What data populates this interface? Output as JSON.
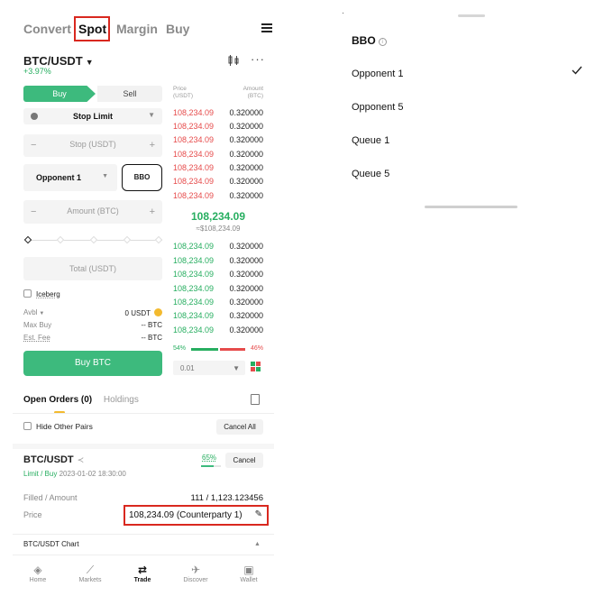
{
  "topnav": {
    "tabs": [
      "Convert",
      "Spot",
      "Margin",
      "Buy"
    ],
    "active": "Spot"
  },
  "pair": {
    "name": "BTC/USDT",
    "change": "+3.97%"
  },
  "form": {
    "buy_label": "Buy",
    "sell_label": "Sell",
    "order_type": "Stop Limit",
    "stop_placeholder": "Stop (USDT)",
    "price_type": "Opponent 1",
    "bbo_label": "BBO",
    "amount_placeholder": "Amount (BTC)",
    "total_placeholder": "Total (USDT)",
    "iceberg_label": "Iceberg",
    "avbl_label": "Avbl",
    "avbl_value": "0 USDT",
    "maxbuy_label": "Max Buy",
    "maxbuy_value": "-- BTC",
    "estfee_label": "Est. Fee",
    "estfee_value": "-- BTC",
    "submit_label": "Buy BTC",
    "minus": "−",
    "plus": "+"
  },
  "orderbook": {
    "price_header": "Price\n(USDT)",
    "amount_header": "Amount\n(BTC)",
    "asks": [
      [
        "108,234.09",
        "0.320000"
      ],
      [
        "108,234.09",
        "0.320000"
      ],
      [
        "108,234.09",
        "0.320000"
      ],
      [
        "108,234.09",
        "0.320000"
      ],
      [
        "108,234.09",
        "0.320000"
      ],
      [
        "108,234.09",
        "0.320000"
      ],
      [
        "108,234.09",
        "0.320000"
      ]
    ],
    "mid_price": "108,234.09",
    "mid_fiat": "≈$108,234.09",
    "bids": [
      [
        "108,234.09",
        "0.320000"
      ],
      [
        "108,234.09",
        "0.320000"
      ],
      [
        "108,234.09",
        "0.320000"
      ],
      [
        "108,234.09",
        "0.320000"
      ],
      [
        "108,234.09",
        "0.320000"
      ],
      [
        "108,234.09",
        "0.320000"
      ],
      [
        "108,234.09",
        "0.320000"
      ]
    ],
    "buy_ratio": "54%",
    "sell_ratio": "46%",
    "depth": "0.01"
  },
  "orders": {
    "tab_open": "Open Orders (0)",
    "tab_holdings": "Holdings",
    "hide_label": "Hide Other Pairs",
    "cancel_all": "Cancel All",
    "item": {
      "pair": "BTC/USDT",
      "type": "Limit / Buy",
      "time": "2023-01-02 18:30:00",
      "filled_pct": "65%",
      "filled_fraction": 0.65,
      "cancel": "Cancel",
      "filled_label": "Filled / Amount",
      "filled_value": "111 / 1,123.123456",
      "price_label": "Price",
      "price_value": "108,234.09 (Counterparty 1)"
    },
    "chart_label": "BTC/USDT Chart"
  },
  "bottom_nav": [
    {
      "label": "Home",
      "icon": "home-icon"
    },
    {
      "label": "Markets",
      "icon": "markets-icon"
    },
    {
      "label": "Trade",
      "icon": "trade-icon"
    },
    {
      "label": "Discover",
      "icon": "discover-icon"
    },
    {
      "label": "Wallet",
      "icon": "wallet-icon"
    }
  ],
  "sheet": {
    "title": "BBO",
    "options": [
      "Opponent 1",
      "Opponent 5",
      "Queue 1",
      "Queue 5"
    ],
    "selected": "Opponent 1"
  },
  "colors": {
    "accent": "#3dba7d",
    "ask": "#e64b4b",
    "bid": "#27ae60",
    "highlight": "#d9281f"
  }
}
